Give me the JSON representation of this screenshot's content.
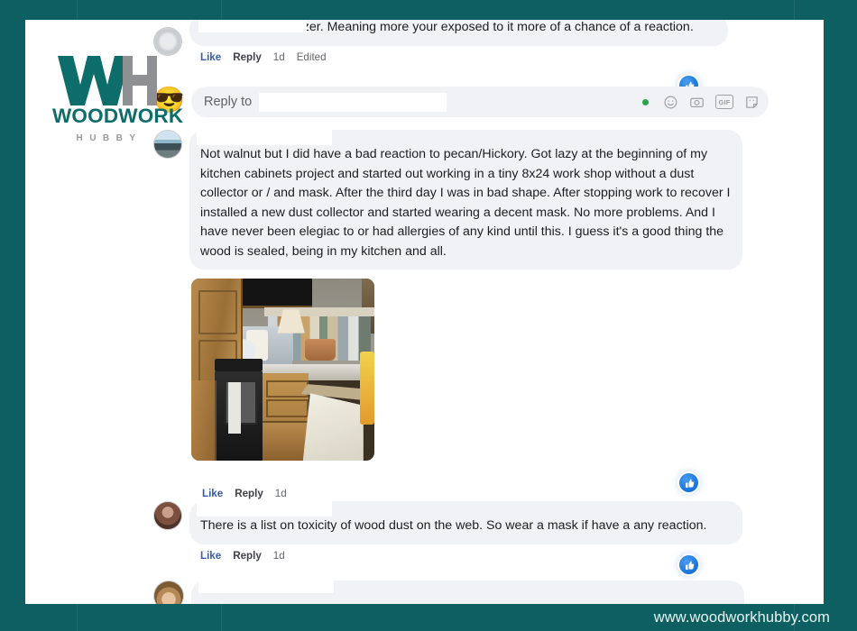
{
  "brand": {
    "logo_initials": "WH",
    "logo_word": "WOODWORK",
    "logo_sub": "HUBBY",
    "footer_url": "www.woodworkhubby.com",
    "teal": "#0d5f61",
    "logo_teal": "#0d6d6a",
    "logo_grey": "#9a9a9a"
  },
  "thread": {
    "comments": [
      {
        "id": "comment-1",
        "avatar": "blurred-avatar",
        "author_redacted": true,
        "text": "Walnut is a sensitizer. Meaning more your exposed to it more of a chance of a reaction.",
        "actions": {
          "like": "Like",
          "reply": "Reply",
          "time": "1d",
          "edited": "Edited"
        },
        "reaction": "like-thumbs-up"
      },
      {
        "id": "comment-2",
        "avatar": "beach-photo-avatar",
        "author_redacted": true,
        "text": "Not walnut but I did have a bad reaction to pecan/Hickory. Got lazy at the beginning of my kitchen cabinets project and started out working in a tiny 8x24 work shop without a dust collector or / and mask. After the third day I was in bad shape. After stopping work to recover I installed a new dust collector and started wearing a decent mask. No more problems. And I have never been elegiac to or had allergies of any kind until this. I guess it's a good thing the wood is sealed, being in my kitchen and all.",
        "attachment": "kitchen-photo",
        "attachment_alt": "Kitchen with wooden cabinets, black stove and light countertop",
        "actions": {
          "like": "Like",
          "reply": "Reply",
          "time": "1d",
          "edited": ""
        },
        "reaction": "like-thumbs-up"
      },
      {
        "id": "comment-3",
        "avatar": "person-avatar-a",
        "author_redacted": true,
        "text": "There is a list on toxicity of wood dust on the web. So wear a mask if have a any reaction.",
        "actions": {
          "like": "Like",
          "reply": "Reply",
          "time": "1d",
          "edited": ""
        },
        "reaction": "like-thumbs-up"
      },
      {
        "id": "comment-4",
        "avatar": "person-avatar-b",
        "author_redacted": true,
        "text": "",
        "actions": {
          "like": "",
          "reply": "",
          "time": "",
          "edited": ""
        },
        "reaction": "like-thumbs-up"
      }
    ],
    "composer": {
      "avatar": "sunglasses-emoji-avatar",
      "placeholder": "Reply to",
      "value": "",
      "status_dot": "online-green-dot",
      "tools": [
        {
          "name": "emoji-icon",
          "label": ""
        },
        {
          "name": "camera-icon",
          "label": ""
        },
        {
          "name": "gif-icon",
          "label": "GIF"
        },
        {
          "name": "sticker-icon",
          "label": ""
        }
      ]
    }
  }
}
